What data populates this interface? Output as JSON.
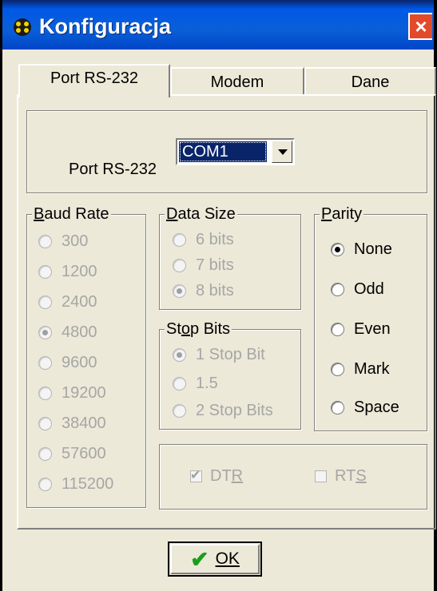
{
  "window": {
    "title": "Konfiguracja",
    "close_glyph": "×"
  },
  "tabs": [
    {
      "label": "Port RS-232",
      "active": true
    },
    {
      "label": "Modem",
      "active": false
    },
    {
      "label": "Dane",
      "active": false
    }
  ],
  "port": {
    "label": "Port RS-232",
    "value": "COM1"
  },
  "baud": {
    "title": "Baud Rate",
    "options": [
      "300",
      "1200",
      "2400",
      "4800",
      "9600",
      "19200",
      "38400",
      "57600",
      "115200"
    ],
    "selected": "4800"
  },
  "data_size": {
    "title": "Data Size",
    "options": [
      "6 bits",
      "7 bits",
      "8 bits"
    ],
    "selected": "8 bits"
  },
  "stop_bits": {
    "title": "Stop Bits",
    "options": [
      "1 Stop Bit",
      "1.5",
      "2 Stop Bits"
    ],
    "selected": "1 Stop Bit"
  },
  "parity": {
    "title": "Parity",
    "options": [
      "None",
      "Odd",
      "Even",
      "Mark",
      "Space"
    ],
    "selected": "None"
  },
  "flow": {
    "dtr_label": "DTR",
    "dtr_checked": true,
    "rts_label": "RTS",
    "rts_checked": false
  },
  "ok_button": {
    "label": "OK"
  },
  "colors": {
    "titlebar": "#0058e6",
    "close": "#e24a2a",
    "face": "#ece9d8",
    "selection": "#0a246a"
  }
}
